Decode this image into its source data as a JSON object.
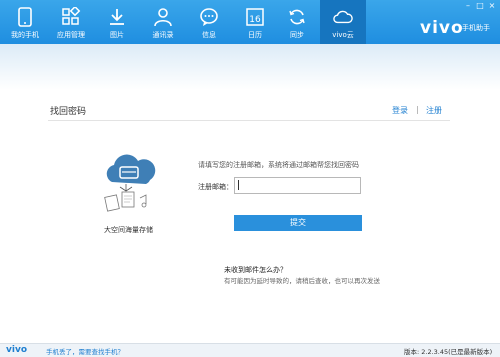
{
  "nav": {
    "items": [
      {
        "label": "我的手机",
        "icon": "phone-icon"
      },
      {
        "label": "应用管理",
        "icon": "apps-grid-icon"
      },
      {
        "label": "图片",
        "icon": "download-icon"
      },
      {
        "label": "通讯录",
        "icon": "contact-person-icon"
      },
      {
        "label": "信息",
        "icon": "message-bubble-icon"
      },
      {
        "label": "日历",
        "icon": "calendar-icon",
        "day": "16"
      },
      {
        "label": "同步",
        "icon": "sync-icon"
      },
      {
        "label": "vivo云",
        "icon": "cloud-icon",
        "active": true
      }
    ]
  },
  "brand": {
    "logo": "vivo",
    "sub": "手机助手"
  },
  "window": {
    "minimize": "–",
    "maximize": "□",
    "close": "×"
  },
  "page": {
    "title": "找回密码",
    "login": "登录",
    "separator": "|",
    "register": "注册"
  },
  "illustration": {
    "caption": "大空间海量存储"
  },
  "form": {
    "hint": "请填写您的注册邮箱，系统将通过邮箱帮您找回密码",
    "email_label": "注册邮箱：",
    "email_value": "",
    "submit": "提交"
  },
  "help": {
    "question": "未收到邮件怎么办？",
    "answer": "有可能因为延时导致的，请稍后查收，也可以再次发送"
  },
  "status": {
    "logo": "vivo",
    "lost_phone": "手机丢了，需要查找手机？",
    "version": "版本: 2.2.3.45(已是最新版本)"
  },
  "colors": {
    "accent": "#1f8ee0",
    "button": "#2a90dc",
    "link": "#1f7fd0"
  }
}
